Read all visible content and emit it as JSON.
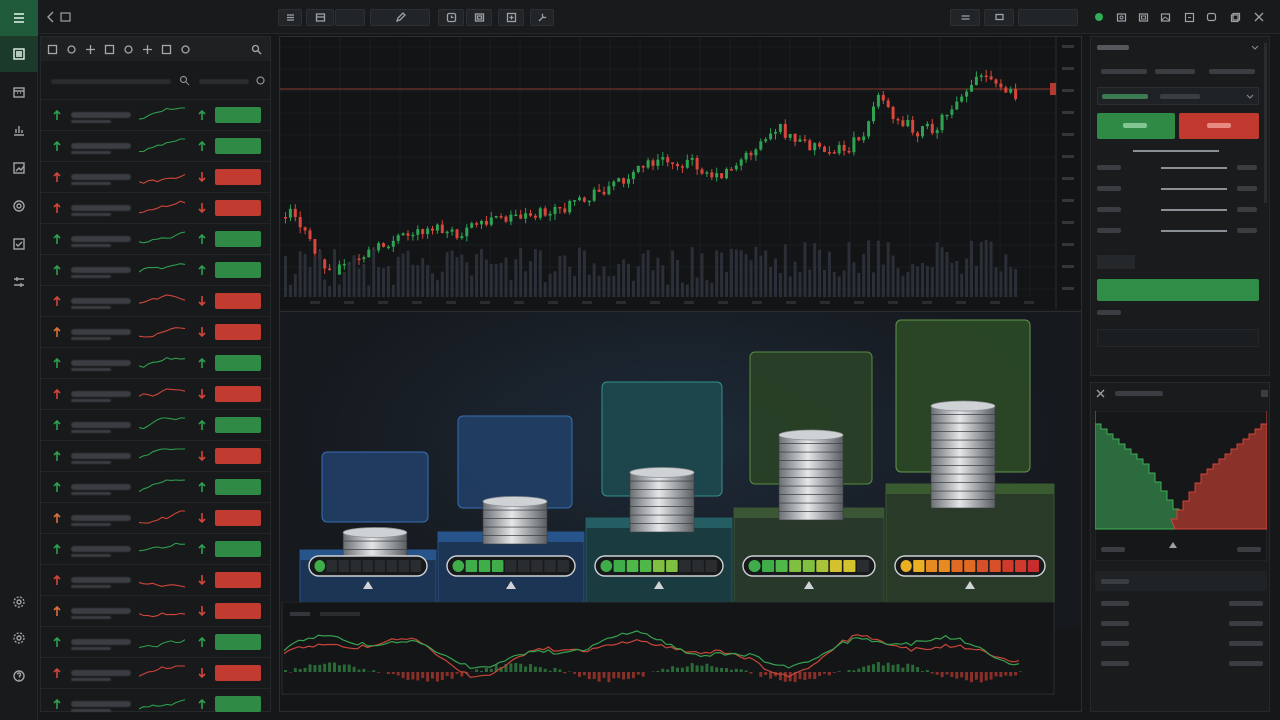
{
  "colors": {
    "bg": "#151719",
    "up": "#2e9e4f",
    "down": "#d2453a",
    "accent": "#1f5a3a",
    "blue": "#2f6aa8",
    "teal": "#2e7a7a",
    "olive": "#4f7a3a"
  },
  "rail": {
    "items": [
      "menu-icon",
      "calendar-icon",
      "chart-icon",
      "trend-icon",
      "target-icon",
      "check-icon",
      "sliders-icon"
    ],
    "bottom": [
      "settings-icon",
      "gear-icon",
      "help-icon"
    ]
  },
  "topbar": {
    "back_icon": "chevron-left-icon",
    "window_icon": "window-icon",
    "groups": [
      "layout",
      "drawing",
      "indicators",
      "tools"
    ],
    "status_dot": "#2fae57"
  },
  "watchlist": {
    "tools": [
      "crop-icon",
      "camera-icon",
      "crosshair-icon",
      "move-icon",
      "brightness-icon",
      "square-icon",
      "check-square-icon",
      "cart-icon"
    ],
    "search_icon": "search-icon",
    "rows": [
      {
        "dir": "up",
        "change": "up"
      },
      {
        "dir": "up",
        "change": "up"
      },
      {
        "dir": "down",
        "change": "down"
      },
      {
        "dir": "down",
        "change": "down"
      },
      {
        "dir": "up",
        "change": "up"
      },
      {
        "dir": "up",
        "change": "up"
      },
      {
        "dir": "down",
        "change": "up-red"
      },
      {
        "dir": "down",
        "change": "down"
      },
      {
        "dir": "up",
        "change": "up"
      },
      {
        "dir": "down",
        "change": "down"
      },
      {
        "dir": "up",
        "change": "up"
      },
      {
        "dir": "up",
        "change": "down"
      },
      {
        "dir": "up",
        "change": "up"
      },
      {
        "dir": "down",
        "change": "down"
      },
      {
        "dir": "up",
        "change": "up"
      },
      {
        "dir": "down",
        "change": "down"
      },
      {
        "dir": "down",
        "change": "up-red"
      },
      {
        "dir": "up",
        "change": "up"
      },
      {
        "dir": "down",
        "change": "down"
      },
      {
        "dir": "up",
        "change": "up"
      }
    ]
  },
  "illustration": {
    "stacks": [
      {
        "coins": 3,
        "meter_filled": 1,
        "meter_total": 9,
        "color": "blue"
      },
      {
        "coins": 5,
        "meter_filled": 4,
        "meter_total": 9,
        "color": "blue"
      },
      {
        "coins": 7,
        "meter_filled": 6,
        "meter_total": 9,
        "color": "teal"
      },
      {
        "coins": 10,
        "meter_filled": 8,
        "meter_total": 9,
        "color": "olive"
      },
      {
        "coins": 12,
        "meter_filled": 11,
        "meter_total": 11,
        "color": "green"
      }
    ]
  },
  "order_panel": {
    "buy_color": "#2e8a45",
    "sell_color": "#c0382e",
    "submit_color": "#2f8d48"
  },
  "depth_panel": {
    "close_icon": "close-icon",
    "bid_color": "#2c6b3d",
    "ask_color": "#8a3129"
  }
}
